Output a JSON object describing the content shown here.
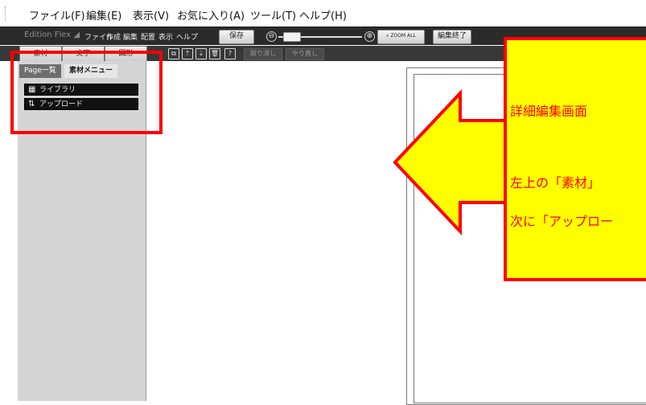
{
  "browser_menu": [
    "ファイル(F)",
    "編集(E)",
    "表示(V)",
    "お気に入り(A)",
    "ツール(T)",
    "ヘルプ(H)"
  ],
  "app_toolbar": {
    "brand": "Edition Flex",
    "menus": [
      "ファイル",
      "作成",
      "編集",
      "配置",
      "表示",
      "ヘルプ"
    ],
    "save": "保存",
    "zoom_minus": "⊖",
    "zoom_plus": "⊕",
    "zoom_all": "ZOOM ALL",
    "finish_edit": "編集終了"
  },
  "sub_toolbar": {
    "tabs": [
      "素材",
      "文字",
      "図形"
    ],
    "undo": "取り消し",
    "redo": "やり直し"
  },
  "left_panel": {
    "tabs": [
      "Page一覧",
      "素材メニュー"
    ],
    "buttons": [
      {
        "label": "ライブラリ",
        "icon": "grid-icon"
      },
      {
        "label": "アップロード",
        "icon": "upload-icon"
      }
    ]
  },
  "callout": {
    "line1": "詳細編集画面",
    "line2": "左上の「素材」",
    "line3": "次に「アップロー"
  },
  "colors": {
    "annotation_red": "#ff0000",
    "callout_yellow": "#ffff00",
    "toolbar_dark": "#2b2b2b"
  }
}
